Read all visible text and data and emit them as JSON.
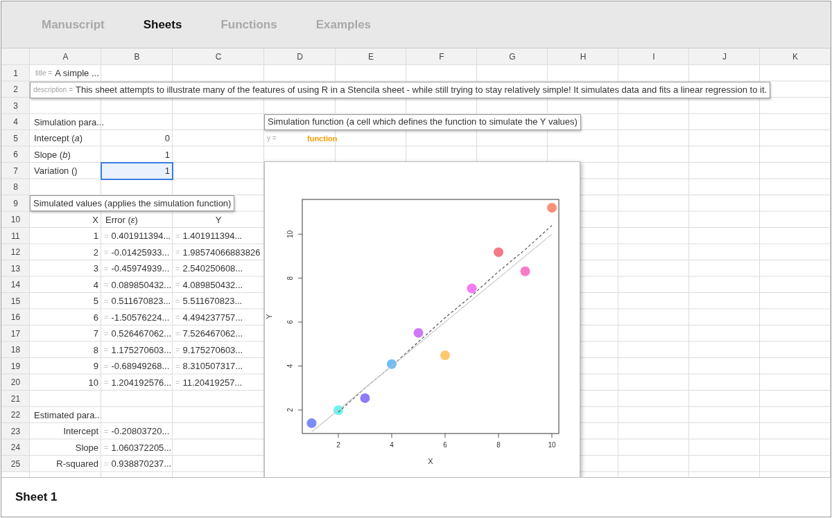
{
  "tabs": [
    {
      "label": "Manuscript",
      "selected": false
    },
    {
      "label": "Sheets",
      "selected": true
    },
    {
      "label": "Functions",
      "selected": false
    },
    {
      "label": "Examples",
      "selected": false
    }
  ],
  "columns": [
    "A",
    "B",
    "C",
    "D",
    "E",
    "F",
    "G",
    "H",
    "I",
    "J",
    "K"
  ],
  "rows": [
    {
      "number": "1",
      "cells": [
        {
          "kind": "named",
          "name": "title =",
          "text": "A simple ...",
          "boxed": false,
          "selected": false
        }
      ]
    },
    {
      "number": "2",
      "cells": [
        {
          "kind": "named",
          "name": "description =",
          "text": "This sheet attempts to illustrate many of the features of using R in a Stencila sheet - while still trying to stay relatively simple! It simulates data and fits a linear regression to it.",
          "boxed": true,
          "selected": false
        }
      ]
    },
    {
      "number": "3",
      "cells": []
    },
    {
      "number": "4",
      "cells": [
        {
          "kind": "text",
          "text": "Simulation para...",
          "selected": false
        },
        null,
        null,
        {
          "kind": "note",
          "text": "Simulation function (a cell which defines the function to simulate the Y values)",
          "selected": false
        }
      ]
    },
    {
      "number": "5",
      "cells": [
        {
          "kind": "text",
          "text": "Intercept (*a*)",
          "selected": false
        },
        {
          "kind": "number",
          "text": "0",
          "selected": false
        },
        null,
        {
          "kind": "function",
          "name": "y =",
          "text": "function",
          "selected": false
        }
      ]
    },
    {
      "number": "6",
      "cells": [
        {
          "kind": "text",
          "text": "Slope (*b*)",
          "selected": false
        },
        {
          "kind": "number",
          "text": "1",
          "selected": false
        }
      ]
    },
    {
      "number": "7",
      "cells": [
        {
          "kind": "text",
          "text": "Variation ()",
          "selected": false
        },
        {
          "kind": "number",
          "text": "1",
          "selected": true
        }
      ]
    },
    {
      "number": "8",
      "cells": []
    },
    {
      "number": "9",
      "cells": [
        {
          "kind": "note",
          "text": "Simulated values (applies the simulation function)",
          "selected": false
        }
      ]
    },
    {
      "number": "10",
      "cells": [
        {
          "kind": "number",
          "text": "X",
          "selected": false
        },
        {
          "kind": "text",
          "text": "Error (*ε*)",
          "selected": false
        },
        {
          "kind": "centered",
          "text": "Y",
          "selected": false
        }
      ]
    },
    {
      "number": "11",
      "cells": [
        {
          "kind": "number",
          "text": "1",
          "selected": false
        },
        {
          "kind": "formula",
          "prefix": "=",
          "text": "0.401911394...",
          "selected": false
        },
        {
          "kind": "formula",
          "prefix": "=",
          "text": "1.401911394...",
          "selected": false
        }
      ]
    },
    {
      "number": "12",
      "cells": [
        {
          "kind": "number",
          "text": "2",
          "selected": false
        },
        {
          "kind": "formula",
          "prefix": "=",
          "text": "-0.01425933...",
          "selected": false
        },
        {
          "kind": "formula",
          "prefix": "=",
          "text": "1.98574066883826",
          "selected": false
        }
      ]
    },
    {
      "number": "13",
      "cells": [
        {
          "kind": "number",
          "text": "3",
          "selected": false
        },
        {
          "kind": "formula",
          "prefix": "=",
          "text": "-0.45974939...",
          "selected": false
        },
        {
          "kind": "formula",
          "prefix": "=",
          "text": "2.540250608...",
          "selected": false
        }
      ]
    },
    {
      "number": "14",
      "cells": [
        {
          "kind": "number",
          "text": "4",
          "selected": false
        },
        {
          "kind": "formula",
          "prefix": "=",
          "text": "0.089850432...",
          "selected": false
        },
        {
          "kind": "formula",
          "prefix": "=",
          "text": "4.089850432...",
          "selected": false
        }
      ]
    },
    {
      "number": "15",
      "cells": [
        {
          "kind": "number",
          "text": "5",
          "selected": false
        },
        {
          "kind": "formula",
          "prefix": "=",
          "text": "0.511670823...",
          "selected": false
        },
        {
          "kind": "formula",
          "prefix": "=",
          "text": "5.511670823...",
          "selected": false
        }
      ]
    },
    {
      "number": "16",
      "cells": [
        {
          "kind": "number",
          "text": "6",
          "selected": false
        },
        {
          "kind": "formula",
          "prefix": "=",
          "text": "-1.50576224...",
          "selected": false
        },
        {
          "kind": "formula",
          "prefix": "=",
          "text": "4.494237757...",
          "selected": false
        }
      ]
    },
    {
      "number": "17",
      "cells": [
        {
          "kind": "number",
          "text": "7",
          "selected": false
        },
        {
          "kind": "formula",
          "prefix": "=",
          "text": "0.526467062...",
          "selected": false
        },
        {
          "kind": "formula",
          "prefix": "=",
          "text": "7.526467062...",
          "selected": false
        }
      ]
    },
    {
      "number": "18",
      "cells": [
        {
          "kind": "number",
          "text": "8",
          "selected": false
        },
        {
          "kind": "formula",
          "prefix": "=",
          "text": "1.175270603...",
          "selected": false
        },
        {
          "kind": "formula",
          "prefix": "=",
          "text": "9.175270603...",
          "selected": false
        }
      ]
    },
    {
      "number": "19",
      "cells": [
        {
          "kind": "number",
          "text": "9",
          "selected": false
        },
        {
          "kind": "formula",
          "prefix": "=",
          "text": "-0.68949268...",
          "selected": false
        },
        {
          "kind": "formula",
          "prefix": "=",
          "text": "8.310507317...",
          "selected": false
        }
      ]
    },
    {
      "number": "20",
      "cells": [
        {
          "kind": "number",
          "text": "10",
          "selected": false
        },
        {
          "kind": "formula",
          "prefix": "=",
          "text": "1.204192576...",
          "selected": false
        },
        {
          "kind": "formula",
          "prefix": "=",
          "text": "11.20419257...",
          "selected": false
        }
      ]
    },
    {
      "number": "21",
      "cells": []
    },
    {
      "number": "22",
      "cells": [
        {
          "kind": "text",
          "text": "Estimated para...",
          "selected": false
        }
      ]
    },
    {
      "number": "23",
      "cells": [
        {
          "kind": "number",
          "text": "Intercept",
          "selected": false
        },
        {
          "kind": "formula",
          "prefix": "=",
          "text": "-0.20803720...",
          "selected": false
        }
      ]
    },
    {
      "number": "24",
      "cells": [
        {
          "kind": "number",
          "text": "Slope",
          "selected": false
        },
        {
          "kind": "formula",
          "prefix": "=",
          "text": "1.060372205...",
          "selected": false
        }
      ]
    },
    {
      "number": "25",
      "cells": [
        {
          "kind": "number",
          "text": "R-squared",
          "selected": false
        },
        {
          "kind": "formula",
          "prefix": "=",
          "text": "0.938870237...",
          "selected": false
        }
      ]
    }
  ],
  "plot": {
    "chart_data": {
      "type": "scatter",
      "xlabel": "X",
      "ylabel": "Y",
      "x": [
        1,
        2,
        3,
        4,
        5,
        6,
        7,
        8,
        9,
        10
      ],
      "series": [
        {
          "type": "scatter",
          "values": [
            1.4,
            1.99,
            2.54,
            4.09,
            5.51,
            4.49,
            7.53,
            9.18,
            8.31,
            11.2
          ],
          "colors": [
            "#7b8cf8",
            "#66f5f0",
            "#8f7af8",
            "#6cc0f8",
            "#cf7af5",
            "#fcc870",
            "#f57af5",
            "#f57a88",
            "#f87ac8",
            "#fa9078"
          ]
        },
        {
          "type": "line",
          "line_style": "dashed",
          "color": "#555555",
          "values": [
            null,
            1.9,
            3.0,
            4.0,
            5.1,
            6.2,
            7.2,
            8.3,
            9.3,
            10.4
          ]
        },
        {
          "type": "line",
          "color": "#c8c8c8",
          "values": [
            1,
            2,
            3,
            4,
            5,
            6,
            7,
            8,
            9,
            10
          ]
        }
      ],
      "xlim": [
        0.65,
        10.26
      ],
      "ylim": [
        0.93,
        11.58
      ],
      "xticks": [
        2,
        4,
        6,
        8,
        10
      ],
      "yticks": [
        2,
        4,
        6,
        8,
        10
      ]
    }
  },
  "sheet_name": "Sheet 1"
}
